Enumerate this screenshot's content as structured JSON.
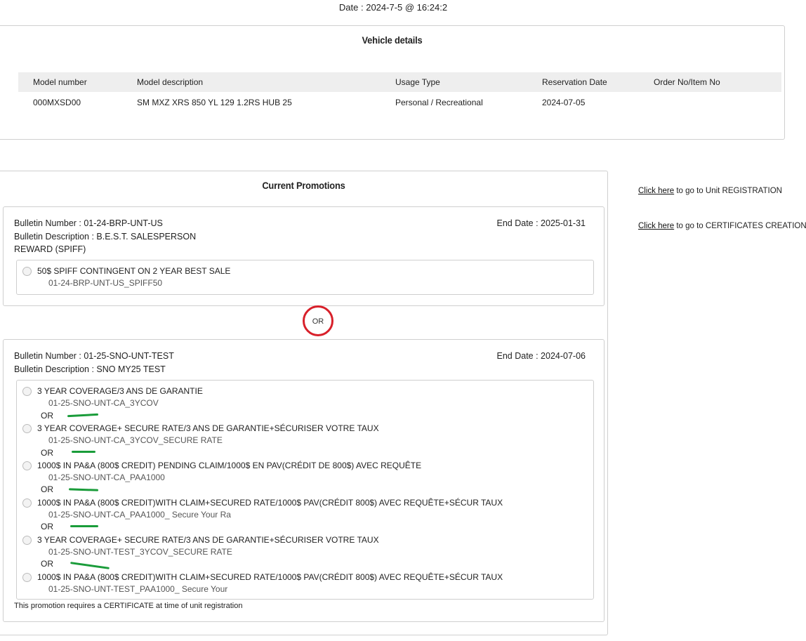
{
  "header": {
    "date": "Date : 2024-7-5 @ 16:24:2"
  },
  "vehicle": {
    "title": "Vehicle details",
    "columns": [
      "Model number",
      "Model description",
      "Usage Type",
      "Reservation Date",
      "Order No/Item No"
    ],
    "row": [
      "000MXSD00",
      "SM MXZ XRS 850 YL 129 1.2RS HUB 25",
      "Personal / Recreational",
      "2024-07-05",
      ""
    ]
  },
  "promotions": {
    "title": "Current Promotions",
    "or_separator": "OR",
    "bulletins": [
      {
        "number": "Bulletin Number : 01-24-BRP-UNT-US",
        "description_line1": "Bulletin Description : B.E.S.T. SALESPERSON",
        "description_line2": "REWARD (SPIFF)",
        "end_date": "End Date : 2025-01-31",
        "options": [
          {
            "title": "50$ SPIFF CONTINGENT ON 2 YEAR BEST SALE",
            "code": "01-24-BRP-UNT-US_SPIFF50"
          }
        ]
      },
      {
        "number": "Bulletin Number : 01-25-SNO-UNT-TEST",
        "description_line1": "Bulletin Description : SNO MY25 TEST",
        "end_date": "End Date : 2024-07-06",
        "options": [
          {
            "title": "3 YEAR COVERAGE/3 ANS DE GARANTIE",
            "code": "01-25-SNO-UNT-CA_3YCOV"
          },
          {
            "title": "3 YEAR COVERAGE+ SECURE RATE/3 ANS DE GARANTIE+SÉCURISER VOTRE TAUX",
            "code": "01-25-SNO-UNT-CA_3YCOV_SECURE RATE"
          },
          {
            "title": "1000$ IN PA&A (800$ CREDIT) PENDING CLAIM/1000$ EN PAV(CRÉDIT DE 800$) AVEC REQUÊTE",
            "code": "01-25-SNO-UNT-CA_PAA1000"
          },
          {
            "title": "1000$ IN PA&A (800$ CREDIT)WITH CLAIM+SECURED RATE/1000$ PAV(CRÉDIT 800$) AVEC REQUÊTE+SÉCUR TAUX",
            "code": "01-25-SNO-UNT-CA_PAA1000_ Secure Your Ra"
          },
          {
            "title": "3 YEAR COVERAGE+ SECURE RATE/3 ANS DE GARANTIE+SÉCURISER VOTRE TAUX",
            "code": "01-25-SNO-UNT-TEST_3YCOV_SECURE RATE"
          },
          {
            "title": "1000$ IN PA&A (800$ CREDIT)WITH CLAIM+SECURED RATE/1000$ PAV(CRÉDIT 800$) AVEC REQUÊTE+SÉCUR TAUX",
            "code": "01-25-SNO-UNT-TEST_PAA1000_ Secure Your"
          }
        ],
        "or_label": "OR",
        "certificate_note": "This promotion requires a CERTIFICATE at time of unit registration"
      }
    ]
  },
  "side_links": [
    {
      "link_text": "Click here",
      "rest": " to go to Unit REGISTRATION"
    },
    {
      "link_text": "Click here",
      "rest": " to go to CERTIFICATES CREATION"
    }
  ],
  "colors": {
    "annotation_circle": "#d8202a",
    "annotation_marks": "#1a9c3a"
  }
}
